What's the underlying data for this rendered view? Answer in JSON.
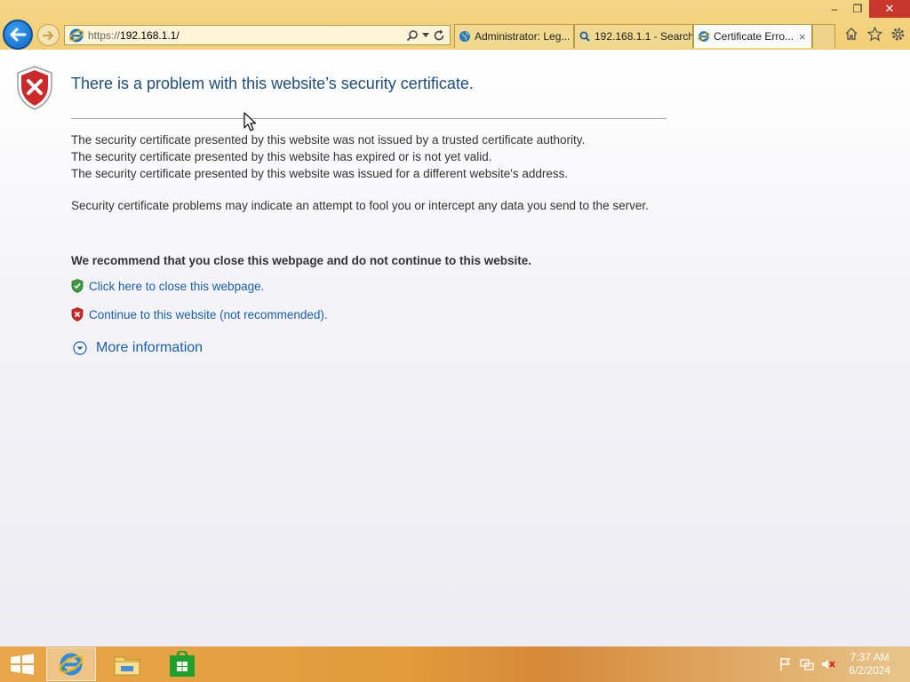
{
  "browser": {
    "address": {
      "protocol": "https://",
      "host": "192.168.1.1/"
    },
    "tabs": [
      {
        "label": "Administrator: Leg...",
        "icon": "globe-icon",
        "active": false
      },
      {
        "label": "192.168.1.1 - Search",
        "icon": "search-icon",
        "active": false
      },
      {
        "label": "Certificate Erro...",
        "icon": "ie-icon",
        "active": true
      }
    ],
    "tab_close": "×",
    "window_controls": {
      "minimize": "–",
      "restore": "❐",
      "close": "✕"
    }
  },
  "page": {
    "title": "There is a problem with this website’s security certificate.",
    "reasons": [
      "The security certificate presented by this website was not issued by a trusted certificate authority.",
      "The security certificate presented by this website has expired or is not yet valid.",
      "The security certificate presented by this website was issued for a different website's address."
    ],
    "warning": "Security certificate problems may indicate an attempt to fool you or intercept any data you send to the server.",
    "recommendation": "We recommend that you close this webpage and do not continue to this website.",
    "close_link": "Click here to close this webpage.",
    "continue_link": "Continue to this website (not recommended).",
    "more_info": "More information"
  },
  "taskbar": {
    "apps": [
      "internet-explorer",
      "file-explorer",
      "store"
    ],
    "clock": {
      "time": "7:37 AM",
      "date": "6/2/2024"
    }
  },
  "colors": {
    "chrome": "#f2cf78",
    "link": "#1a5fa8",
    "title": "#1f4e79",
    "taskbar": "#e29a3a"
  }
}
